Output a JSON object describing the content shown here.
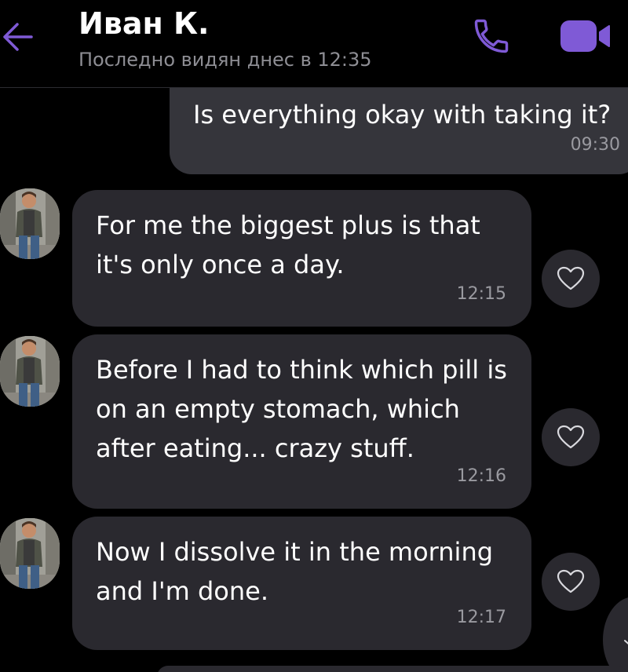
{
  "header": {
    "contact_name": "Иван К.",
    "last_seen": "Последно видян днес в 12:35",
    "accent_color": "#7f5ad6"
  },
  "messages": [
    {
      "direction": "outgoing",
      "text": "Is everything okay with taking it?",
      "time": "09:30"
    },
    {
      "direction": "incoming",
      "text": "For me the biggest plus is that it's only once a day.",
      "time": "12:15"
    },
    {
      "direction": "incoming",
      "text": "Before I had to think which pill is on an empty stomach, which after eating... crazy stuff.",
      "time": "12:16"
    },
    {
      "direction": "incoming",
      "text": "Now I dissolve it in the morning and I'm done.",
      "time": "12:17"
    }
  ],
  "icons": {
    "back": "arrow-left-icon",
    "call": "phone-icon",
    "video": "video-camera-icon",
    "like": "heart-icon",
    "scroll": "chevron-down-icon"
  }
}
